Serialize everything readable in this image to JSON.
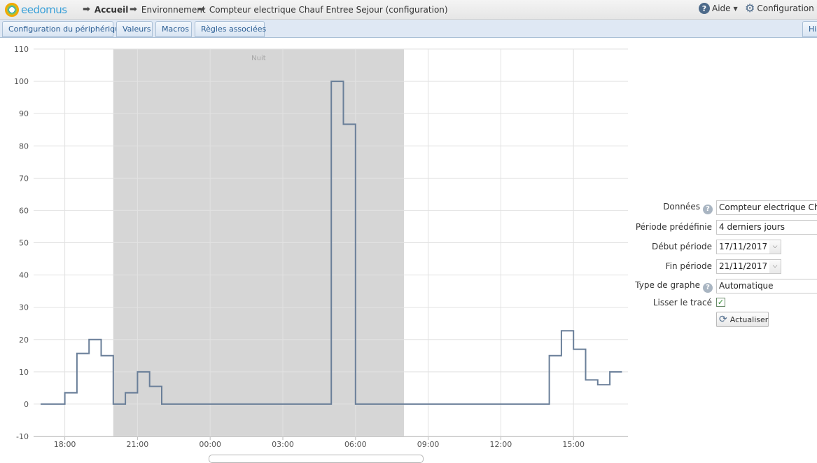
{
  "app": {
    "logo_text": "eedomus"
  },
  "breadcrumb": [
    {
      "label": "Accueil"
    },
    {
      "label": "Environnement"
    },
    {
      "label": "Compteur electrique Chauf Entree Sejour (configuration)"
    }
  ],
  "header": {
    "help_label": "Aide",
    "help_icon": "?",
    "config_label": "Configuration"
  },
  "tabs": [
    {
      "label": "Configuration du périphérique"
    },
    {
      "label": "Valeurs"
    },
    {
      "label": "Macros"
    },
    {
      "label": "Règles associées"
    },
    {
      "label": "His"
    }
  ],
  "form": {
    "data_label": "Données",
    "data_value": "Compteur electrique Chauf Entree Sejour",
    "period_label": "Période prédéfinie",
    "period_value": "4 derniers jours",
    "start_label": "Début période",
    "start_value": "17/11/2017",
    "end_label": "Fin période",
    "end_value": "21/11/2017",
    "graph_type_label": "Type de graphe",
    "graph_type_value": "Automatique",
    "smooth_label": "Lisser le tracé",
    "smooth_checked": true,
    "refresh_label": "Actualiser",
    "help_icon": "?"
  },
  "chart_data": {
    "type": "line",
    "step": true,
    "ylim": [
      -10,
      110
    ],
    "yticks": [
      110,
      100,
      90,
      80,
      70,
      60,
      50,
      40,
      30,
      20,
      10,
      0,
      -10
    ],
    "xlim": [
      17.0,
      40.0
    ],
    "xticks": [
      {
        "label": "18:00",
        "x": 18
      },
      {
        "label": "21:00",
        "x": 21
      },
      {
        "label": "00:00",
        "x": 24
      },
      {
        "label": "03:00",
        "x": 27
      },
      {
        "label": "06:00",
        "x": 30
      },
      {
        "label": "09:00",
        "x": 33
      },
      {
        "label": "12:00",
        "x": 36
      },
      {
        "label": "15:00",
        "x": 39
      }
    ],
    "band": {
      "label": "Nuit",
      "from": 20,
      "to": 32
    },
    "grid": true,
    "line_color": "#6a7f99",
    "band_color": "#d6d6d6",
    "series": [
      {
        "points": [
          [
            17.0,
            0
          ],
          [
            18.0,
            3.5
          ],
          [
            18.5,
            15.7
          ],
          [
            19.0,
            20
          ],
          [
            19.5,
            15
          ],
          [
            20.0,
            0
          ],
          [
            20.5,
            3.5
          ],
          [
            21.0,
            10
          ],
          [
            21.5,
            5.5
          ],
          [
            22.0,
            0
          ],
          [
            29.0,
            100
          ],
          [
            29.5,
            86.7
          ],
          [
            30.0,
            0
          ],
          [
            38.0,
            15
          ],
          [
            38.5,
            22.7
          ],
          [
            39.0,
            17
          ],
          [
            39.5,
            7.5
          ],
          [
            40.0,
            6
          ],
          [
            40.5,
            10
          ]
        ],
        "end_x": 41.0
      }
    ]
  }
}
